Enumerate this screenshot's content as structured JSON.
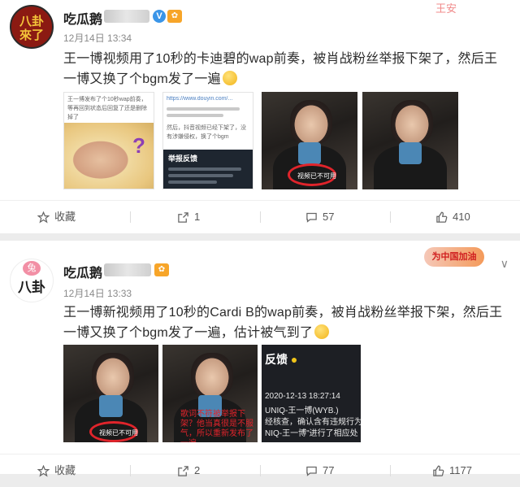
{
  "post1": {
    "avatar_text": "八卦\n來了",
    "author": "吃瓜鹅",
    "verified_badge": "V",
    "time": "12月14日 13:34",
    "text": "王一博视频用了10秒的卡迪碧的wap前奏，被肖战粉丝举报下架了，然后王一博又换了个bgm发了一遍",
    "images": {
      "doc_left_caption": "王一博发布了个10秒wap前奏，等再回到状态后回复了还是删除掉了",
      "doc_right_url": "https://www.douyin.com/...",
      "doc_right_note": "然后，抖音视频已经下架了，没有涉嫌侵权，换了个bgm",
      "doc_right_card_title": "举报反馈",
      "ring_label": "视频已不可用"
    },
    "actions": {
      "favorite_label": "收藏",
      "repost_count": "1",
      "comment_count": "57",
      "like_count": "410"
    },
    "top_deco": "王安"
  },
  "post2": {
    "avatar_top": "兔",
    "avatar_text": "八卦",
    "author": "吃瓜鹅",
    "promo": "为中国加油",
    "time": "12月14日 13:33",
    "text": "王一博新视频用了10秒的Cardi B的wap前奏，被肖战粉丝举报下架，然后王一博又换了个bgm发了一遍，估计被气到了",
    "images": {
      "ring_label": "视频已不可用",
      "red_overlay": "歌词不符被举报下架？他当真很是不服气，所以重新发布了一遍",
      "feedback_title": "反馈",
      "feedback_time": "2020-12-13 18:27:14",
      "feedback_user": "UNIQ-王一博(WYB.)",
      "feedback_line1": "经核查，确认含有违规行为",
      "feedback_line2": "NIQ-王一博\"进行了相应处"
    },
    "actions": {
      "favorite_label": "收藏",
      "repost_count": "2",
      "comment_count": "77",
      "like_count": "1177"
    }
  }
}
